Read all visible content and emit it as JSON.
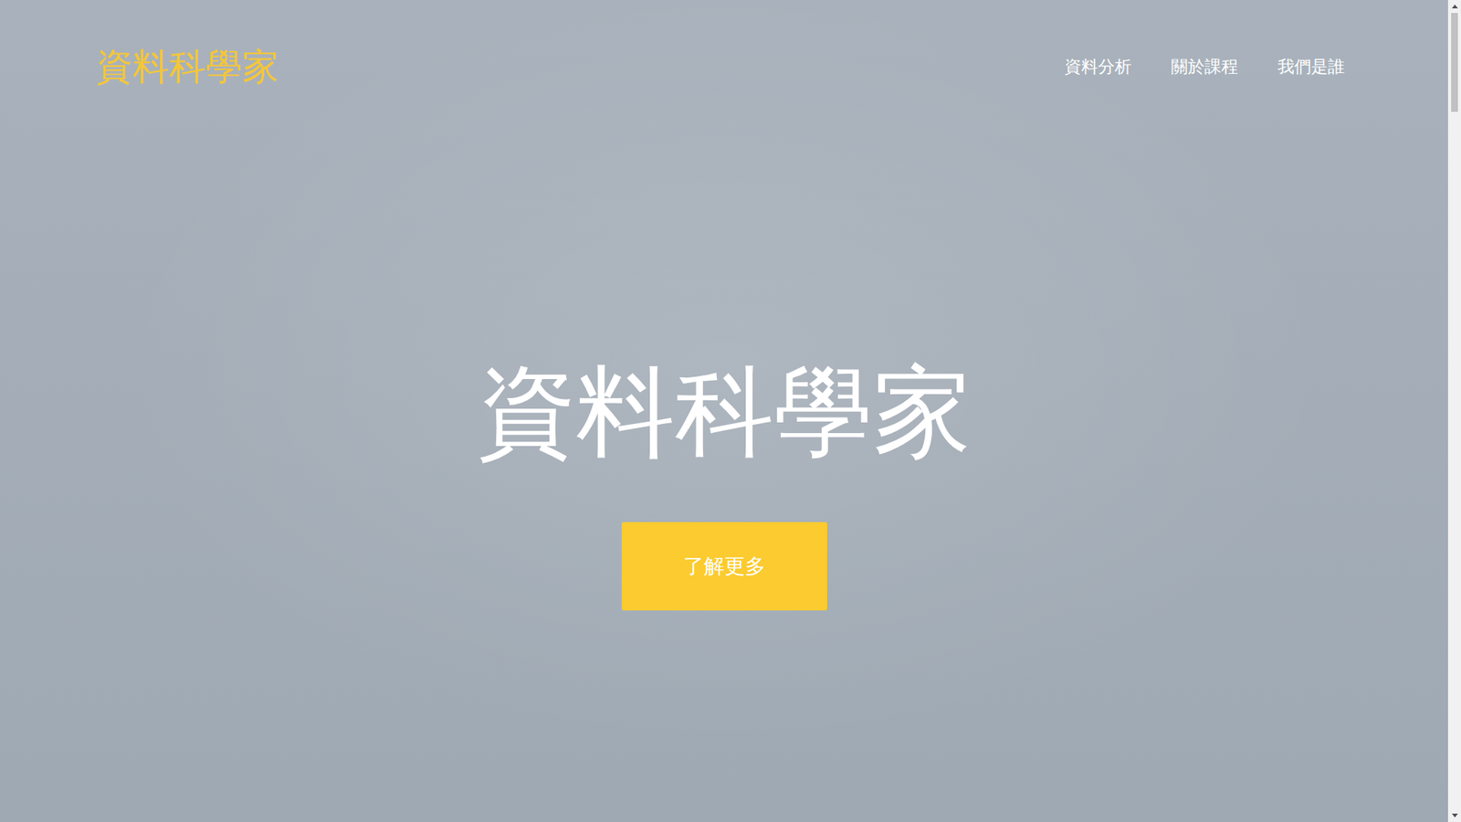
{
  "logo": "資料科學家",
  "nav": [
    {
      "label": "資料分析"
    },
    {
      "label": "關於課程"
    },
    {
      "label": "我們是誰"
    }
  ],
  "hero": {
    "title": "資料科學家",
    "button": "了解更多"
  }
}
